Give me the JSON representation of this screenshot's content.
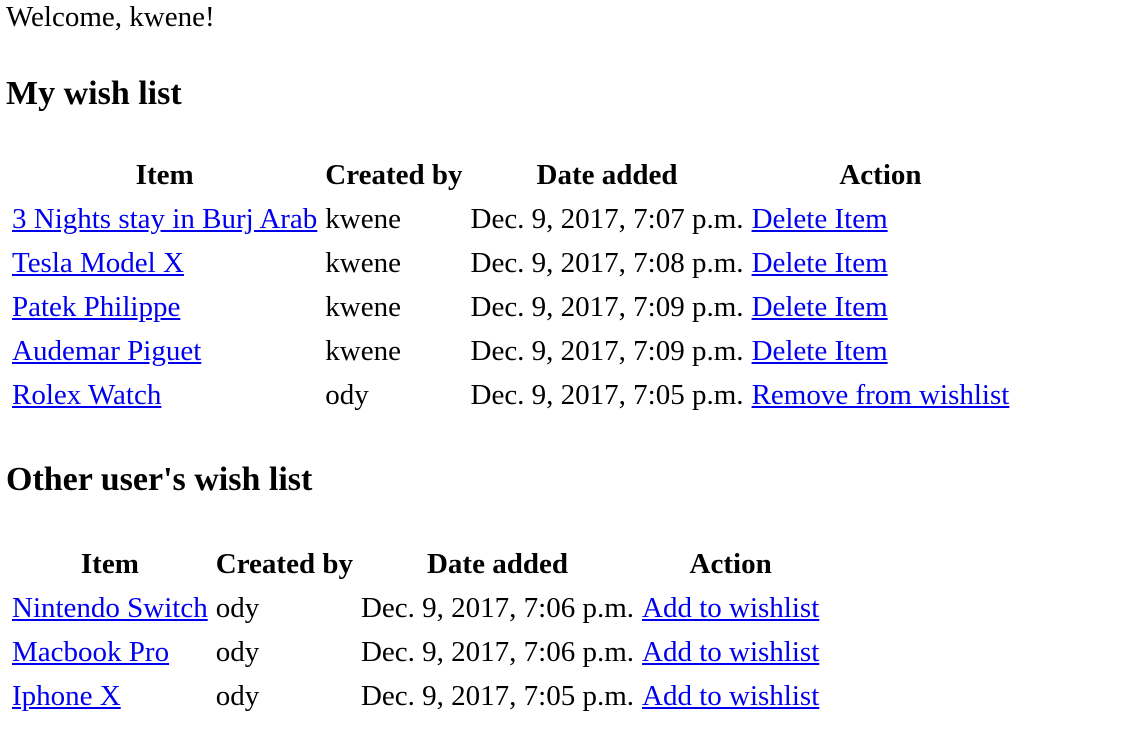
{
  "welcome_text": "Welcome, kwene!",
  "colors": {
    "link": "#0000ee",
    "text": "#000000",
    "background": "#ffffff"
  },
  "my_list": {
    "heading": "My wish list",
    "columns": [
      "Item",
      "Created by",
      "Date added",
      "Action"
    ],
    "rows": [
      {
        "item": "3 Nights stay in Burj Arab",
        "created_by": "kwene",
        "date_added": "Dec. 9, 2017, 7:07 p.m.",
        "action": "Delete Item"
      },
      {
        "item": "Tesla Model X",
        "created_by": "kwene",
        "date_added": "Dec. 9, 2017, 7:08 p.m.",
        "action": "Delete Item"
      },
      {
        "item": "Patek Philippe",
        "created_by": "kwene",
        "date_added": "Dec. 9, 2017, 7:09 p.m.",
        "action": "Delete Item"
      },
      {
        "item": "Audemar Piguet",
        "created_by": "kwene",
        "date_added": "Dec. 9, 2017, 7:09 p.m.",
        "action": "Delete Item"
      },
      {
        "item": "Rolex Watch",
        "created_by": "ody",
        "date_added": "Dec. 9, 2017, 7:05 p.m.",
        "action": "Remove from wishlist"
      }
    ]
  },
  "other_list": {
    "heading": "Other user's wish list",
    "columns": [
      "Item",
      "Created by",
      "Date added",
      "Action"
    ],
    "rows": [
      {
        "item": "Nintendo Switch",
        "created_by": "ody",
        "date_added": "Dec. 9, 2017, 7:06 p.m.",
        "action": "Add to wishlist"
      },
      {
        "item": "Macbook Pro",
        "created_by": "ody",
        "date_added": "Dec. 9, 2017, 7:06 p.m.",
        "action": "Add to wishlist"
      },
      {
        "item": "Iphone X",
        "created_by": "ody",
        "date_added": "Dec. 9, 2017, 7:05 p.m.",
        "action": "Add to wishlist"
      }
    ]
  }
}
